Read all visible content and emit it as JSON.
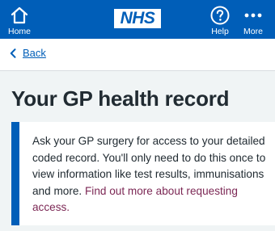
{
  "header": {
    "home_label": "Home",
    "logo_text": "NHS",
    "help_label": "Help",
    "more_label": "More"
  },
  "nav": {
    "back_label": "Back"
  },
  "page": {
    "title": "Your GP health record",
    "inset_text": "Ask your GP surgery for access to your detailed coded record. You'll only need to do this once to view information like test results, immunisations and more.",
    "inset_link": "Find out more about requesting access."
  },
  "colors": {
    "brand_blue": "#005eb8",
    "background": "#f0f4f5",
    "text": "#212b32",
    "link_visited": "#7c2855"
  },
  "icons": [
    "home-icon",
    "help-icon",
    "more-icon",
    "chevron-left-icon"
  ]
}
